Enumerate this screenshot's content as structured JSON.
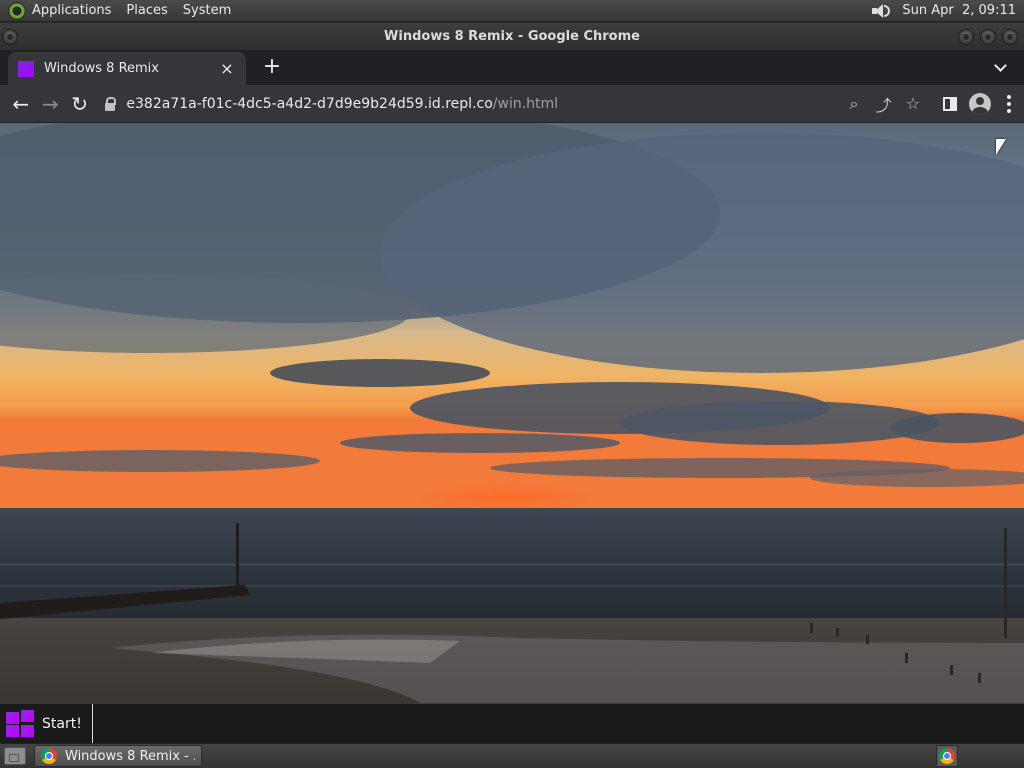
{
  "top_panel": {
    "menus": [
      "Applications",
      "Places",
      "System"
    ],
    "clock": "Sun Apr  2, 09:11",
    "icons": {
      "logo": "gnome-foot-icon",
      "volume": "volume-icon"
    }
  },
  "window": {
    "title": "Windows 8 Remix - Google Chrome"
  },
  "browser": {
    "tab": {
      "title": "Windows 8 Remix",
      "close_glyph": "×"
    },
    "new_tab_glyph": "+",
    "nav": {
      "back": "←",
      "forward": "→",
      "reload": "↻"
    },
    "url": {
      "host": "e382a71a-f01c-4dc5-a4d2-d7d9e9b24d59.id.repl.co",
      "path": "/win.html"
    },
    "toolbar_glyphs": {
      "zoom": "⌕",
      "share": "⤴",
      "bookmark": "☆"
    }
  },
  "page": {
    "wallpaper": "sunset-over-sea",
    "start_button": {
      "label": "Start!"
    },
    "colors": {
      "accent": "#9b19f5"
    }
  },
  "bottom_panel": {
    "task": {
      "label": "Windows 8 Remix - ..."
    }
  }
}
